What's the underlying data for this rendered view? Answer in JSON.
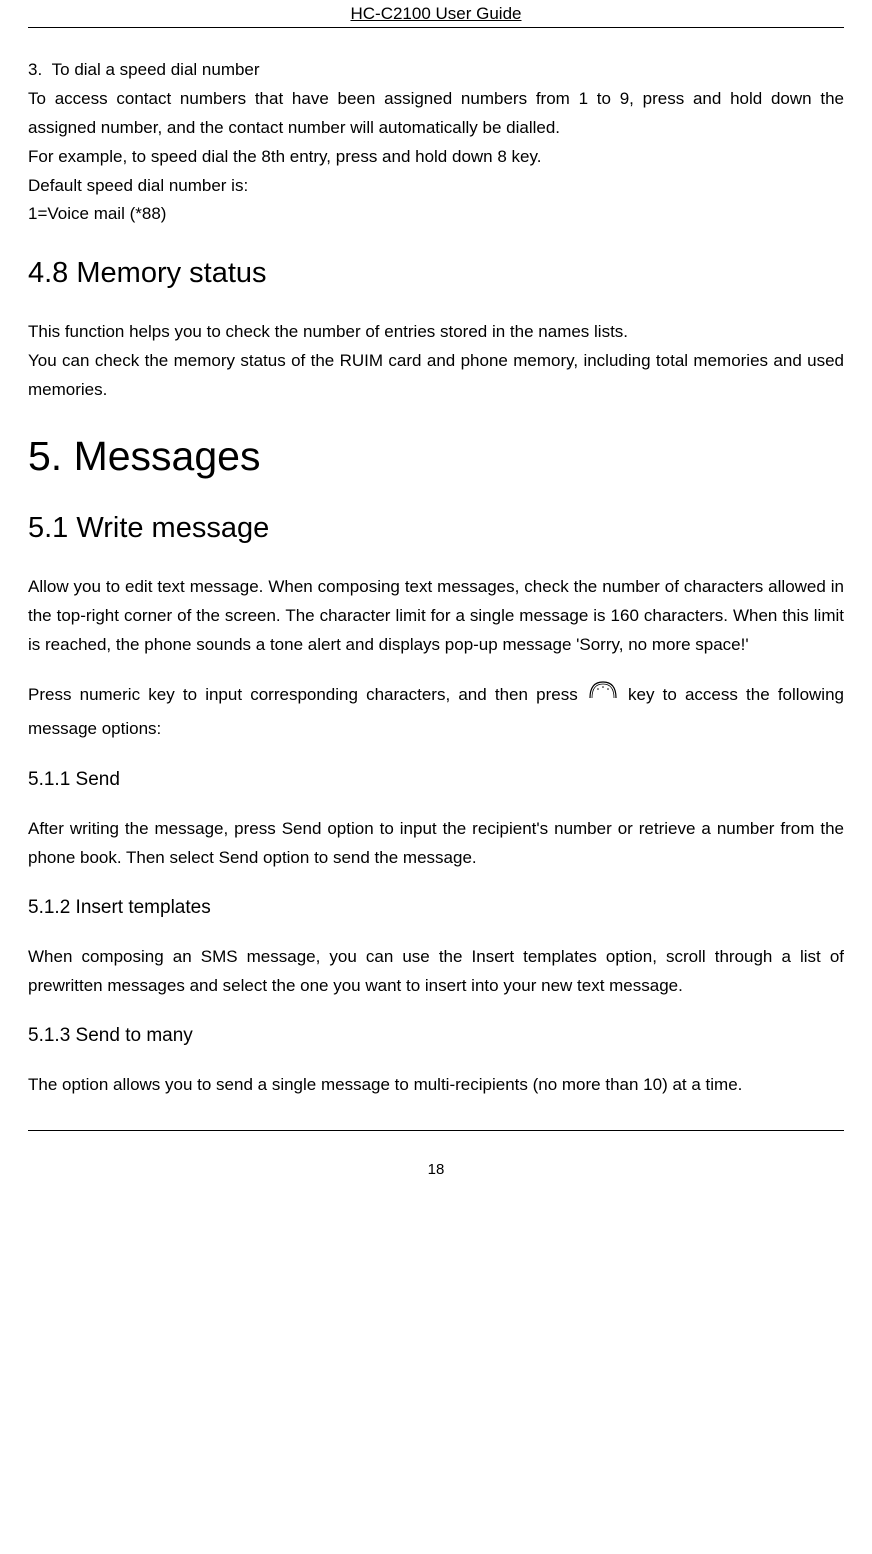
{
  "header": {
    "title": "HC-C2100 User Guide"
  },
  "section_3": {
    "item_number": "3.",
    "item_title": "To dial a speed dial number",
    "para1": "To access contact numbers that have been assigned numbers from 1 to 9, press and hold down the assigned number, and the contact number will automatically be dialled.",
    "para2": "For example, to speed dial the 8th entry, press and hold down 8 key.",
    "para3": "Default speed dial number is:",
    "para4": "1=Voice mail (*88)"
  },
  "section_48": {
    "heading": "4.8 Memory status",
    "para1": "This function helps you to check the number of entries stored in the names lists.",
    "para2": "You can check the memory status of the RUIM card and phone memory, including total memories and used memories."
  },
  "section_5": {
    "heading": "5. Messages"
  },
  "section_51": {
    "heading": "5.1 Write message",
    "para1": "Allow you to edit text message. When composing text messages, check the number of characters allowed in the top-right corner of the screen. The character limit for a single message is 160 characters. When this limit is reached, the phone sounds a tone alert and displays pop-up message 'Sorry, no more space!'",
    "para2_before": "Press numeric key to input corresponding characters, and then press ",
    "para2_after": " key to access the following message options:"
  },
  "section_511": {
    "heading": "5.1.1 Send",
    "para1": "After writing the message, press Send option to input the recipient's number or retrieve a number from the phone book. Then select Send option to send the message."
  },
  "section_512": {
    "heading": "5.1.2 Insert templates",
    "para1": "When composing an SMS message, you can use the Insert templates option, scroll through a list of prewritten messages and select the one you want to insert into your new text message."
  },
  "section_513": {
    "heading": "5.1.3 Send to many",
    "para1": "The option allows you to send a single message to multi-recipients (no more than 10) at a time."
  },
  "footer": {
    "page_number": "18"
  }
}
